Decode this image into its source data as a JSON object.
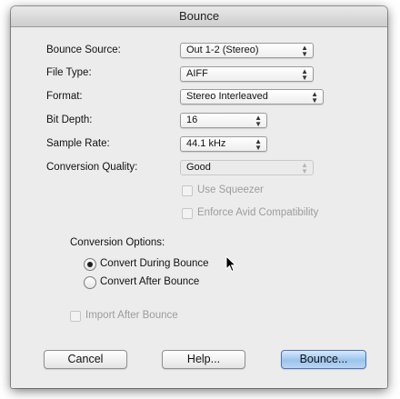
{
  "window": {
    "title": "Bounce"
  },
  "fields": {
    "bounce_source": {
      "label": "Bounce Source:",
      "value": "Out 1-2 (Stereo)"
    },
    "file_type": {
      "label": "File Type:",
      "value": "AIFF"
    },
    "format": {
      "label": "Format:",
      "value": "Stereo Interleaved"
    },
    "bit_depth": {
      "label": "Bit Depth:",
      "value": "16"
    },
    "sample_rate": {
      "label": "Sample Rate:",
      "value": "44.1 kHz"
    },
    "conversion_quality": {
      "label": "Conversion Quality:",
      "value": "Good",
      "enabled": false
    }
  },
  "checkboxes": {
    "use_squeezer": {
      "label": "Use Squeezer",
      "checked": false,
      "enabled": false
    },
    "enforce_avid": {
      "label": "Enforce Avid Compatibility",
      "checked": false,
      "enabled": false
    },
    "import_after": {
      "label": "Import After Bounce",
      "checked": false,
      "enabled": false
    }
  },
  "conversion_options": {
    "label": "Conversion Options:",
    "during": {
      "label": "Convert During Bounce",
      "selected": true
    },
    "after": {
      "label": "Convert After Bounce",
      "selected": false
    }
  },
  "buttons": {
    "cancel": "Cancel",
    "help": "Help...",
    "bounce": "Bounce..."
  },
  "colors": {
    "window_bg": "#ececec",
    "default_button": "#9cc3ed",
    "disabled_text": "#9c9c9c"
  }
}
